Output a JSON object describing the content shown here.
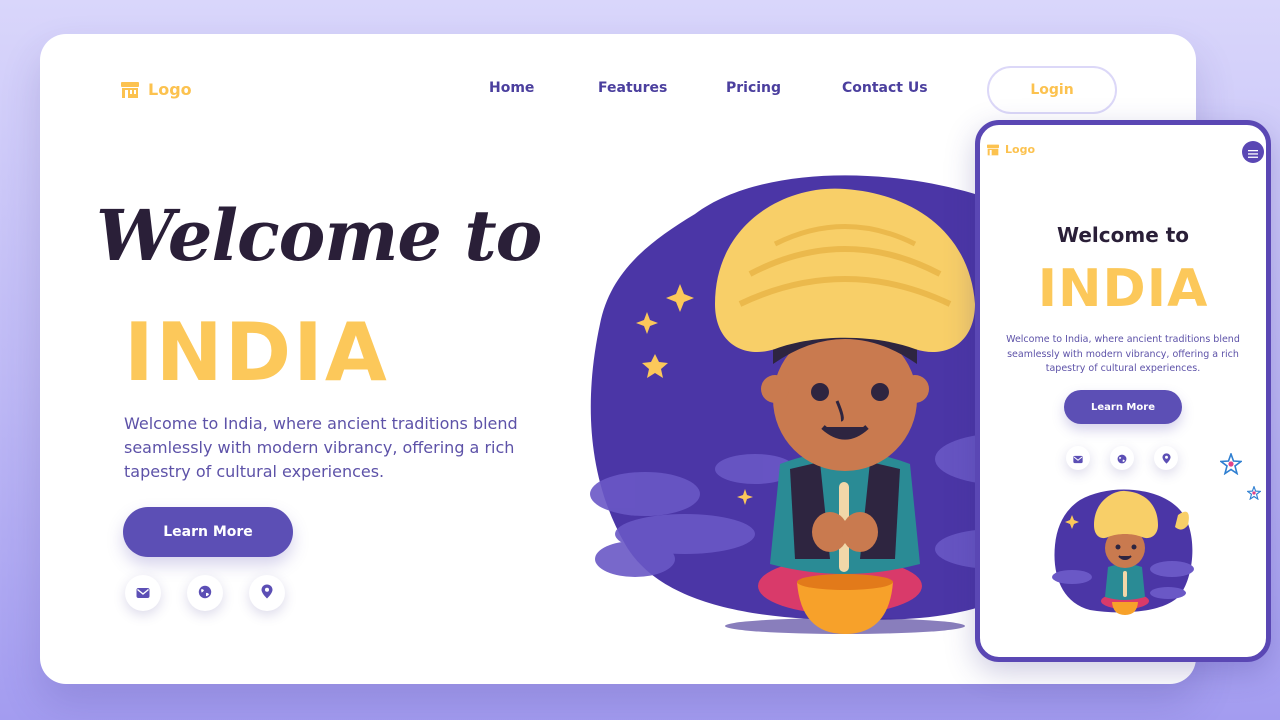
{
  "desktop": {
    "logo": {
      "text": "Logo",
      "icon": "store-icon"
    },
    "nav": [
      {
        "label": "Home"
      },
      {
        "label": "Features"
      },
      {
        "label": "Pricing"
      },
      {
        "label": "Contact Us"
      }
    ],
    "login_label": "Login",
    "hero": {
      "welcome": "Welcome to",
      "title": "INDIA",
      "description": "Welcome to India, where ancient traditions blend seamlessly with modern vibrancy, offering a rich tapestry of cultural experiences.",
      "cta_label": "Learn More"
    },
    "social": [
      "mail-icon",
      "globe-icon",
      "location-pin-icon"
    ]
  },
  "mobile": {
    "logo": {
      "text": "Logo",
      "icon": "store-icon"
    },
    "menu_icon": "hamburger-menu-icon",
    "welcome": "Welcome to",
    "title": "INDIA",
    "description": "Welcome to India, where ancient traditions blend seamlessly with modern vibrancy, offering a rich tapestry of cultural experiences.",
    "cta_label": "Learn More",
    "social": [
      "mail-icon",
      "globe-icon",
      "location-pin-icon"
    ]
  },
  "colors": {
    "background": "#c6c2f7",
    "brand_purple": "#5c4fb5",
    "nav_text": "#4b3f9e",
    "accent_yellow": "#fcc24f",
    "heading_dark": "#2a1f38",
    "body_text": "#5d52a8"
  }
}
